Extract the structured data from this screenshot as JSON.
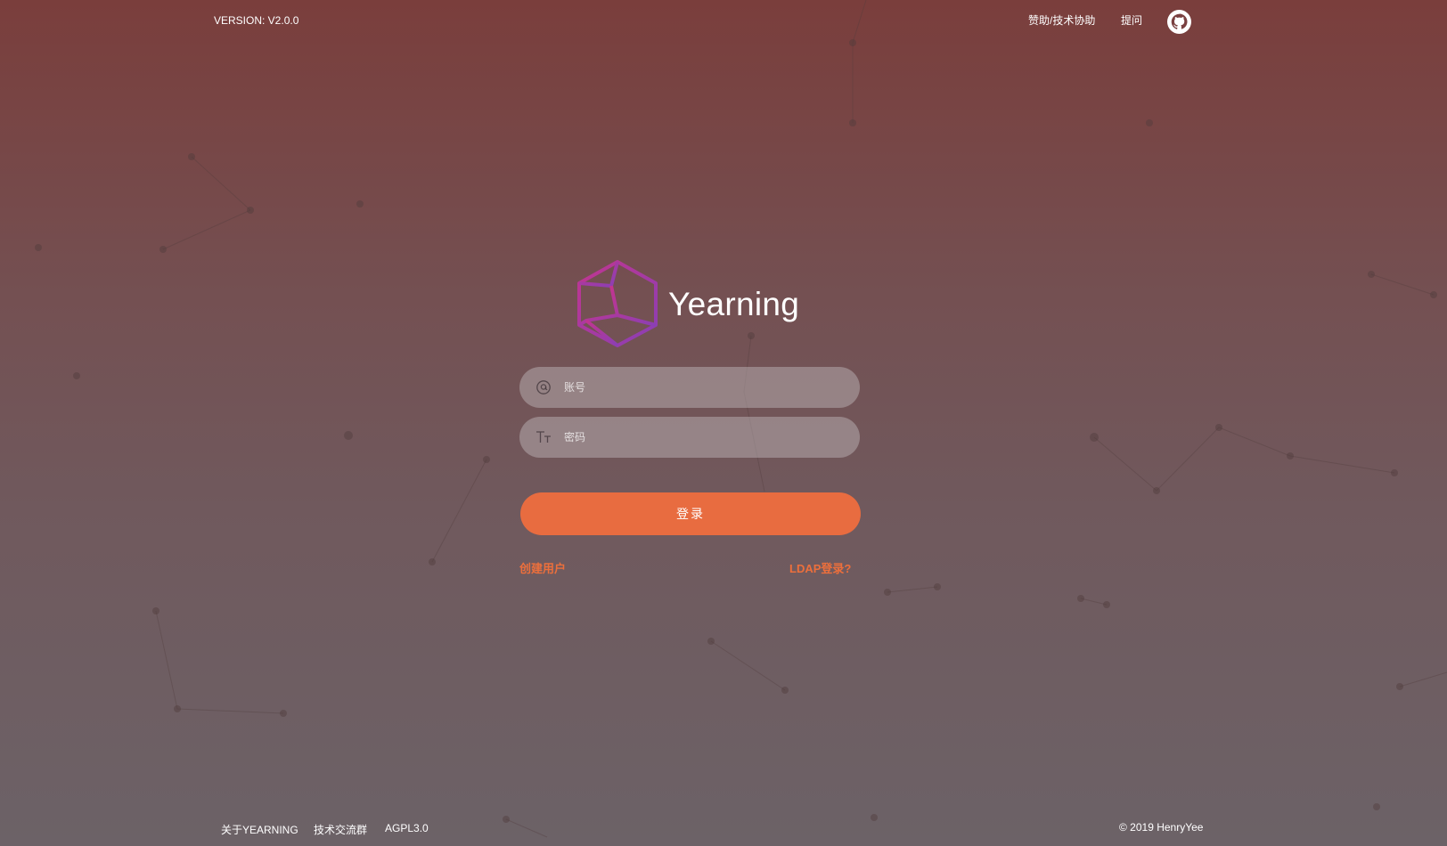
{
  "header": {
    "version": "VERSION: V2.0.0",
    "sponsor_link": "赞助/技术协助",
    "ask_link": "提问",
    "github_icon": "github-icon"
  },
  "brand": {
    "name": "Yearning",
    "logo_icon": "hexagon-cube-logo",
    "logo_colors": [
      "#c2358f",
      "#8a3fb5"
    ]
  },
  "login_form": {
    "username_placeholder": "账号",
    "username_icon": "at-icon",
    "password_placeholder": "密码",
    "password_icon": "text-icon",
    "submit_label": "登录",
    "create_user_link": "创建用户",
    "ldap_link": "LDAP登录?"
  },
  "footer": {
    "links": [
      "关于YEARNING",
      "技术交流群",
      "AGPL3.0"
    ],
    "copyright": "© 2019 HenryYee"
  },
  "colors": {
    "accent": "#e86c40",
    "link": "#ec6f3c",
    "background_top": "#7a3e3c",
    "background_bottom": "#6c6267"
  }
}
